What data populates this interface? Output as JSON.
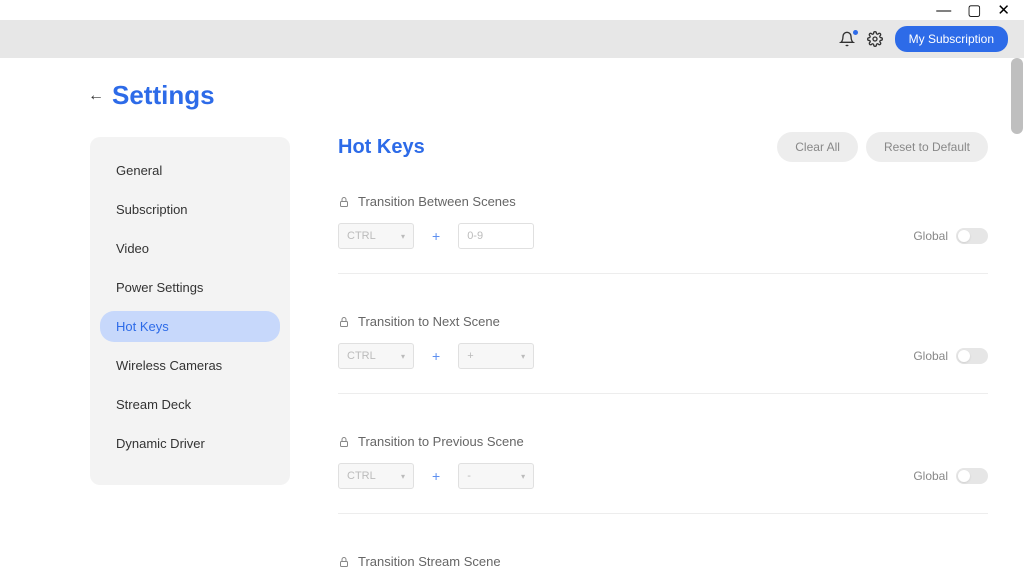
{
  "window_controls": {
    "minimize": "—",
    "maximize": "▢",
    "close": "✕"
  },
  "topbar": {
    "subscription_label": "My Subscription"
  },
  "header": {
    "title": "Settings"
  },
  "sidebar": {
    "items": [
      {
        "label": "General",
        "active": false
      },
      {
        "label": "Subscription",
        "active": false
      },
      {
        "label": "Video",
        "active": false
      },
      {
        "label": "Power Settings",
        "active": false
      },
      {
        "label": "Hot Keys",
        "active": true
      },
      {
        "label": "Wireless Cameras",
        "active": false
      },
      {
        "label": "Stream Deck",
        "active": false
      },
      {
        "label": "Dynamic Driver",
        "active": false
      }
    ]
  },
  "main": {
    "title": "Hot Keys",
    "clear_all": "Clear All",
    "reset_default": "Reset to Default",
    "global_label": "Global",
    "hotkeys": [
      {
        "label": "Transition Between Scenes",
        "modifier": "CTRL",
        "second_value": "0-9",
        "second_is_text": true
      },
      {
        "label": "Transition to Next Scene",
        "modifier": "CTRL",
        "second_value": "+",
        "second_is_text": false
      },
      {
        "label": "Transition to Previous Scene",
        "modifier": "CTRL",
        "second_value": "-",
        "second_is_text": false
      },
      {
        "label": "Transition Stream Scene",
        "modifier": "",
        "second_value": "",
        "second_is_text": false,
        "partial": true
      }
    ]
  }
}
